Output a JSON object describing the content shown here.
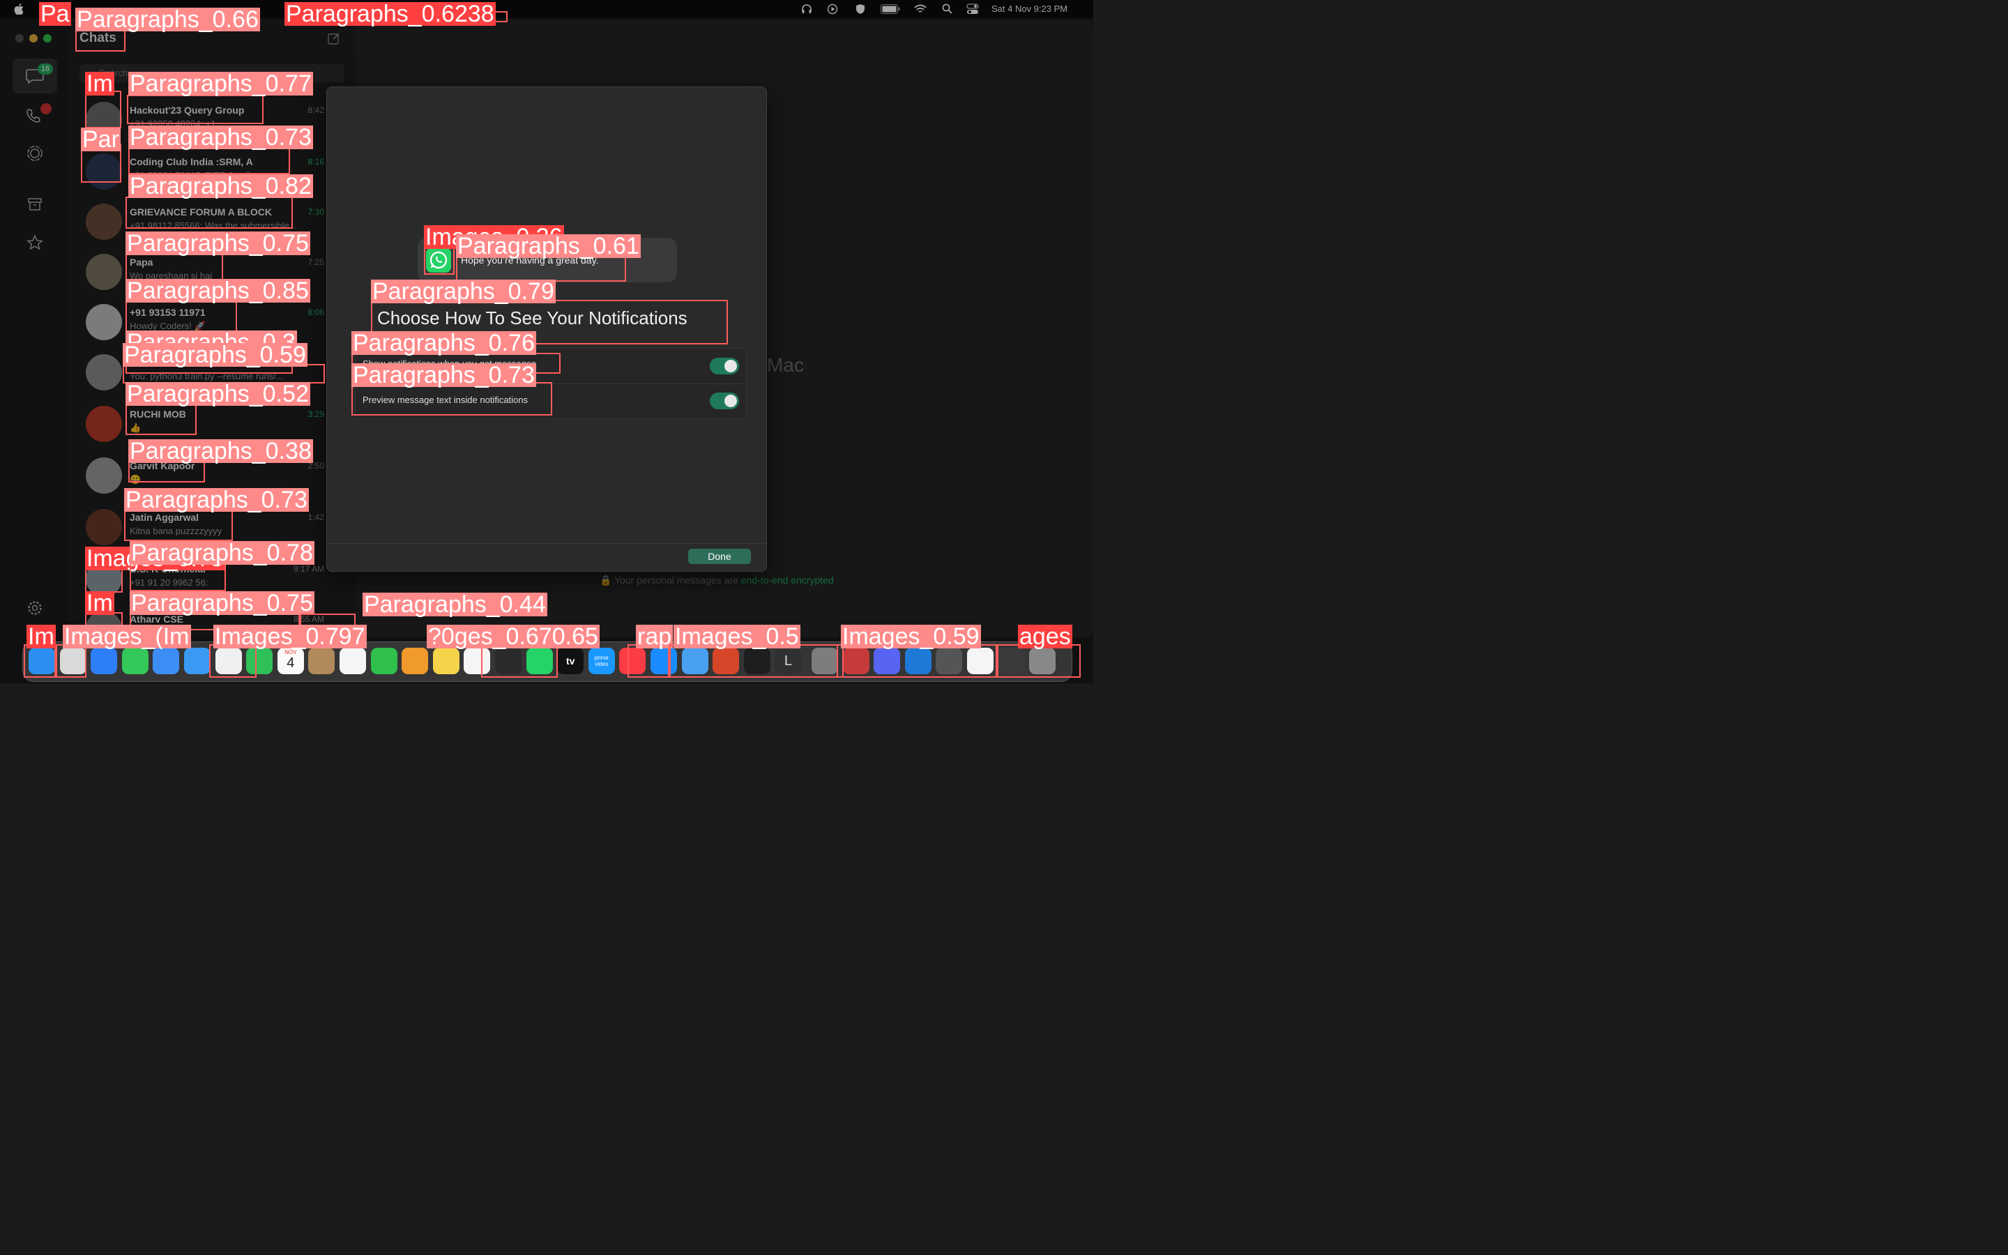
{
  "menubar": {
    "apple_logo": "apple-logo",
    "status_icons": [
      "headphones-icon",
      "play-icon",
      "shield-icon",
      "battery-icon",
      "wifi-icon",
      "search-icon",
      "control-center-icon"
    ],
    "datetime": "Sat 4 Nov  9:23 PM"
  },
  "window": {
    "sidebar_title": "Chats",
    "search_placeholder": "Search",
    "rail": {
      "chats_badge": "16",
      "icons": [
        "chat-icon",
        "phone-icon",
        "status-icon",
        "archive-icon",
        "star-icon",
        "settings-icon"
      ]
    },
    "chats": [
      {
        "name": "Hackout'23 Query Group",
        "preview": "+91 92058 48264: +1",
        "time": "8:42",
        "time_green": false
      },
      {
        "name": "Coding Club India :SRM, A",
        "preview": "+91 88001 79915: TIER 3 colleg...",
        "time": "8:16",
        "time_green": true
      },
      {
        "name": "GRIEVANCE FORUM A BLOCK",
        "preview": "+91 98112 85566: Was the submersible...",
        "time": "7:30",
        "time_green": true
      },
      {
        "name": "Papa",
        "preview": "Wo pareshaan si hai",
        "time": "7:25",
        "time_green": false
      },
      {
        "name": "+91 93153 11971",
        "preview": "Howdy Coders! 🚀",
        "time": "6:06",
        "time_green": true
      },
      {
        "name": "",
        "preview": "You: python3 train.py --resume runs/...",
        "time": "",
        "time_green": false
      },
      {
        "name": "RUCHI MOB",
        "preview": "👍",
        "time": "3:29",
        "time_green": true
      },
      {
        "name": "Garvit Kapoor",
        "preview": "😀",
        "time": "2:50",
        "time_green": false
      },
      {
        "name": "Jatin Aggarwal",
        "preview": "Kitna bana puzzzzyyyy",
        "time": "1:42",
        "time_green": false
      },
      {
        "name": "C.S. K Unofficial",
        "preview": "+91 91 20 9962 56:",
        "time": "9:17 AM",
        "time_green": false
      },
      {
        "name": "Atharv CSE",
        "preview": "",
        "time": "8:55 AM",
        "time_green": false
      }
    ],
    "main_bg_text": "Mac",
    "encrypted_text": "Your personal messages are",
    "encrypted_link": "end-to-end encrypted"
  },
  "dialog": {
    "sample_notification": "Hope you’re having a great day.",
    "title": "Choose How To See Your Notifications",
    "option_1": "Show notifications when you get messages",
    "option_2": "Preview message text inside notifications",
    "option_1_on": true,
    "option_2_on": true,
    "done_button": "Done"
  },
  "dock": {
    "calendar_month": "NOV",
    "calendar_day": "4",
    "l_app": "L",
    "tv_label": "tv",
    "prime_label": "prime video",
    "apps": [
      "finder-icon",
      "launchpad-icon",
      "safari-icon",
      "messages-icon",
      "mail-icon",
      "maps-icon",
      "photos-icon",
      "facetime-icon",
      "calendar-icon",
      "contacts-icon",
      "reminders-icon",
      "numbers-icon",
      "pages-icon",
      "notes-icon",
      "freeform-icon",
      "stocks-icon",
      "whatsapp-icon",
      "appletv-icon",
      "primevideo-icon",
      "music-icon",
      "appstore-icon",
      "weather-icon",
      "remote-desktop-icon",
      "terminal-icon",
      "l-app-icon",
      "system-settings-icon",
      "photo-booth-icon",
      "discord-icon",
      "vscode-icon",
      "rocket-icon",
      "document-icon",
      "screenshot-icon",
      "trash-icon"
    ]
  },
  "detections": [
    {
      "label": "Paragraphs_0.6238"
    },
    {
      "label": "Paragraphs_0.66"
    },
    {
      "label": "Pa"
    },
    {
      "label": "Paragraphs_0.77"
    },
    {
      "label": "Im"
    },
    {
      "label": "Paragraphs_0.73"
    },
    {
      "label": "Par"
    },
    {
      "label": "Paragraphs_0.82"
    },
    {
      "label": "Images_0.36"
    },
    {
      "label": "Paragraphs_0.61"
    },
    {
      "label": "Paragraphs_0.75"
    },
    {
      "label": "Paragraphs_0.85"
    },
    {
      "label": "Paragraphs_0.79"
    },
    {
      "label": "Paragraphs_0.3"
    },
    {
      "label": "Paragraphs_0.76"
    },
    {
      "label": "Paragraphs_0.59"
    },
    {
      "label": "Paragraphs_0.73"
    },
    {
      "label": "Paragraphs_0.52"
    },
    {
      "label": "Paragraphs_0.38"
    },
    {
      "label": "Paragraphs_0.73"
    },
    {
      "label": "Images_0.78"
    },
    {
      "label": "Paragraphs_0.78"
    },
    {
      "label": "Im"
    },
    {
      "label": "Paragraphs_0.75"
    },
    {
      "label": "Paragraphs_0.44"
    },
    {
      "label": "Im"
    },
    {
      "label": "Images_(Im"
    },
    {
      "label": "Images_0.797"
    },
    {
      "label": "?0ges_0.670.65"
    },
    {
      "label": "rap"
    },
    {
      "label": "Images_0.5"
    },
    {
      "label": "Images_0.59"
    },
    {
      "label": "ages"
    }
  ]
}
